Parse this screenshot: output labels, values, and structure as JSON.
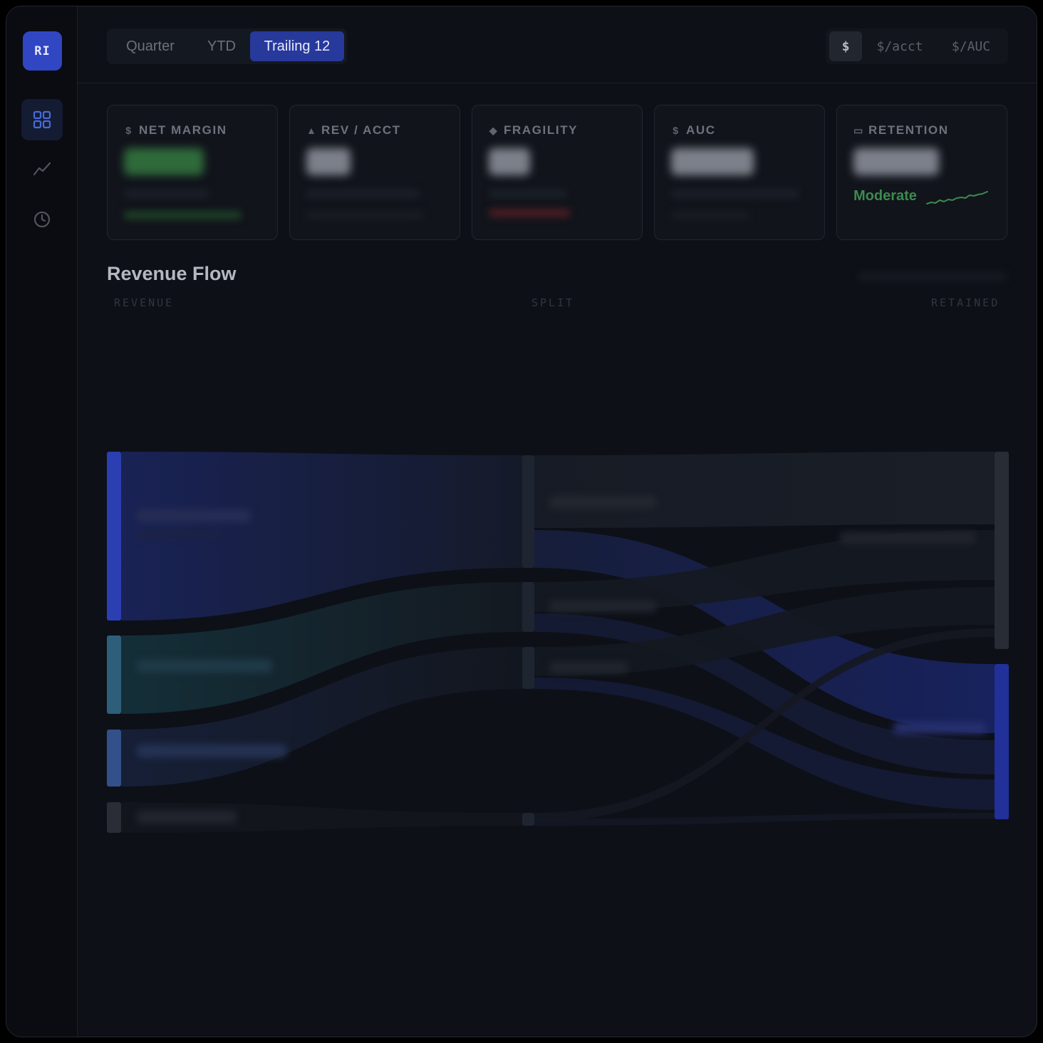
{
  "sidebar": {
    "logo": "RI",
    "nav": [
      {
        "icon": "dashboard-grid-icon",
        "active": true
      },
      {
        "icon": "trend-line-icon",
        "active": false
      },
      {
        "icon": "clock-icon",
        "active": false
      }
    ]
  },
  "period_tabs": [
    "Quarter",
    "YTD",
    "Trailing 12"
  ],
  "period_active": "Trailing 12",
  "unit_tabs": [
    "$",
    "$/acct",
    "$/AUC"
  ],
  "unit_active": "$",
  "metrics": [
    {
      "label": "NET MARGIN",
      "icon": "$",
      "accent": "#3a9a4e"
    },
    {
      "label": "REV / ACCT",
      "icon": "▲",
      "accent": "#8f94a0"
    },
    {
      "label": "FRAGILITY",
      "icon": "◆",
      "accent": "#8f94a0"
    },
    {
      "label": "AUC",
      "icon": "$",
      "accent": "#8f94a0"
    },
    {
      "label": "RETENTION",
      "icon": "▭",
      "accent": "#8f94a0",
      "status": "Moderate",
      "status_color": "#3c8a4f"
    }
  ],
  "section": {
    "title": "Revenue Flow",
    "columns": [
      "REVENUE",
      "SPLIT",
      "RETAINED"
    ]
  },
  "colors": {
    "accent_blue": "#2c3fb2",
    "teal": "#2e5f7a",
    "slate_blue": "#34508a",
    "positive_green": "#3c8a4f"
  }
}
